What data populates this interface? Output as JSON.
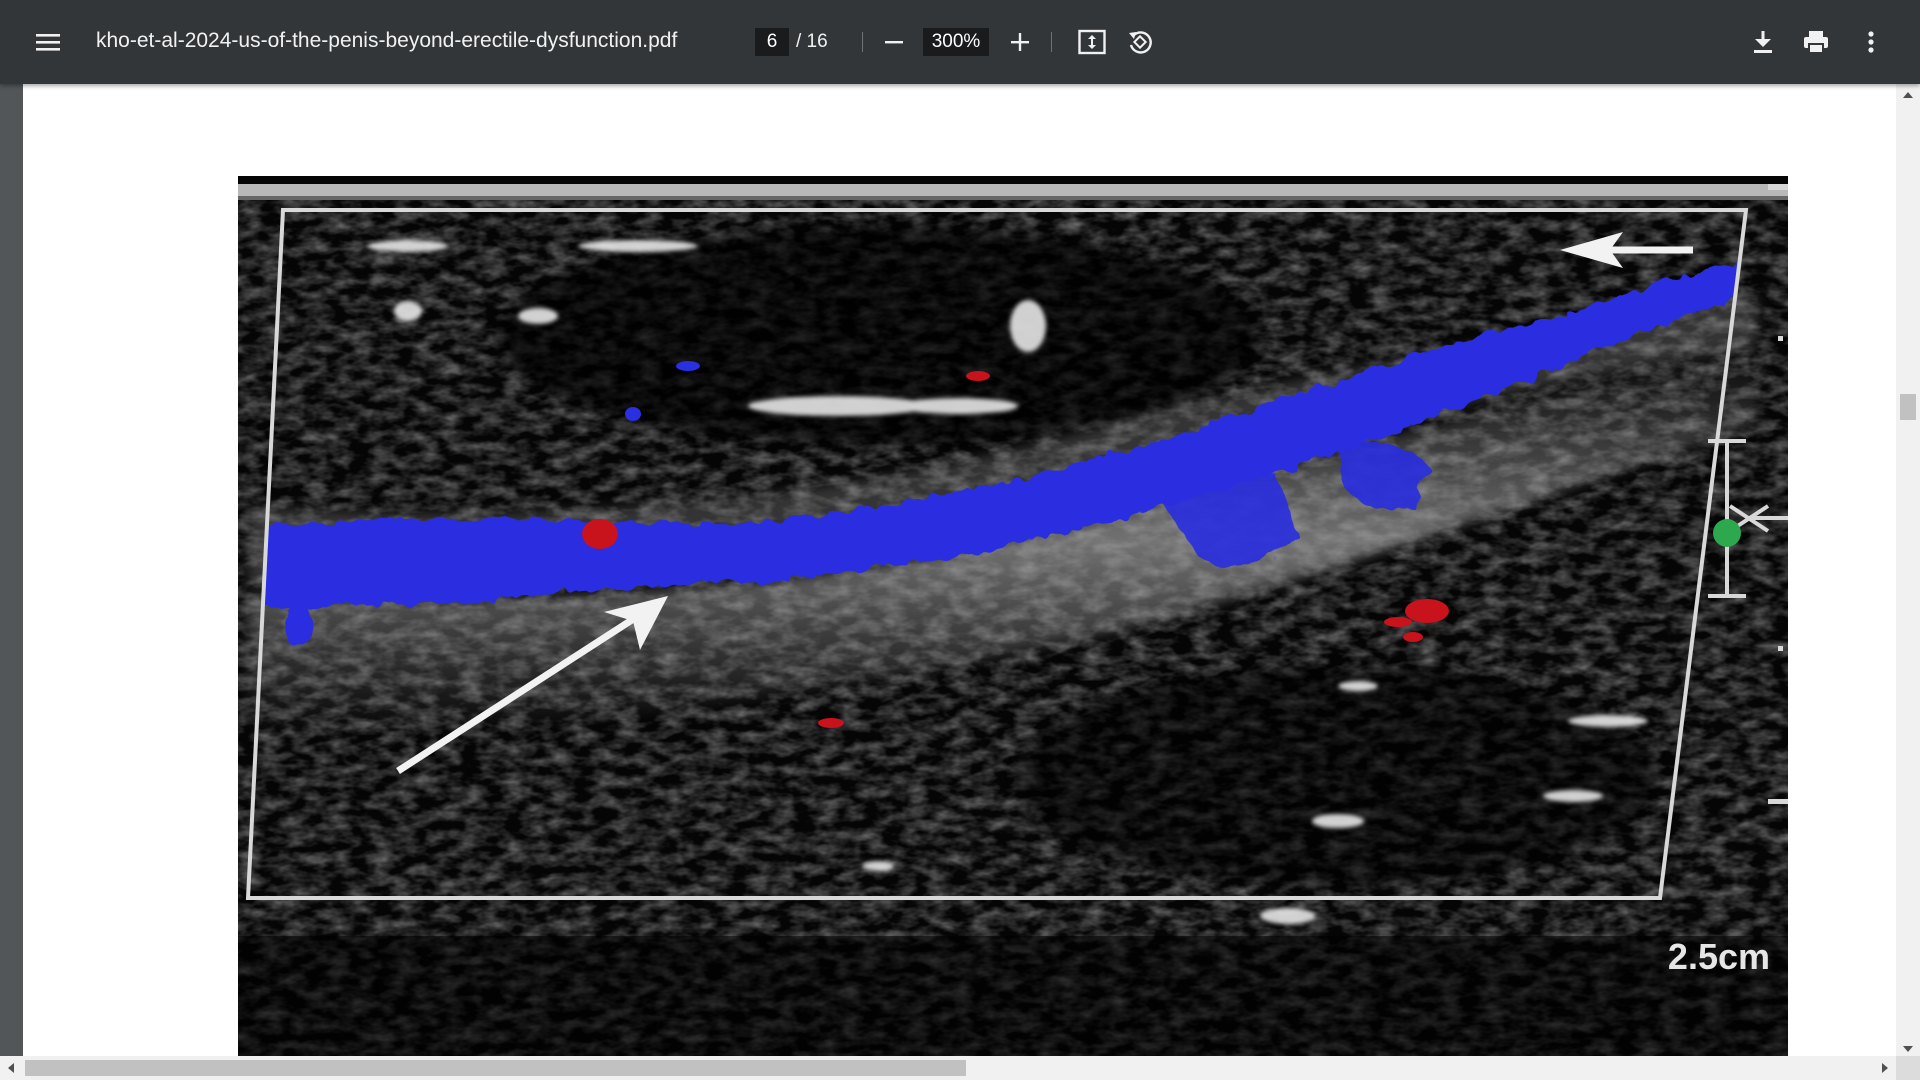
{
  "toolbar": {
    "menu_icon": "hamburger-menu-icon",
    "file_name": "kho-et-al-2024-us-of-the-penis-beyond-erectile-dysfunction.pdf",
    "current_page": "6",
    "page_total": "/ 16",
    "zoom_level": "300%",
    "zoom_out_icon": "minus-icon",
    "zoom_in_icon": "plus-icon",
    "fit_icon": "fit-to-page-icon",
    "rotate_icon": "rotate-counterclockwise-icon",
    "download_icon": "download-icon",
    "print_icon": "print-icon",
    "more_icon": "more-vertical-icon"
  },
  "figure": {
    "scale_label": "2.5cm",
    "colors": {
      "doppler_blue": "#2a2fe0",
      "doppler_red": "#c8121c",
      "marker_green": "#2ea84f"
    }
  },
  "colors": {
    "toolbar_bg": "#323639",
    "viewer_bg": "#525659",
    "page_bg": "#ffffff"
  }
}
